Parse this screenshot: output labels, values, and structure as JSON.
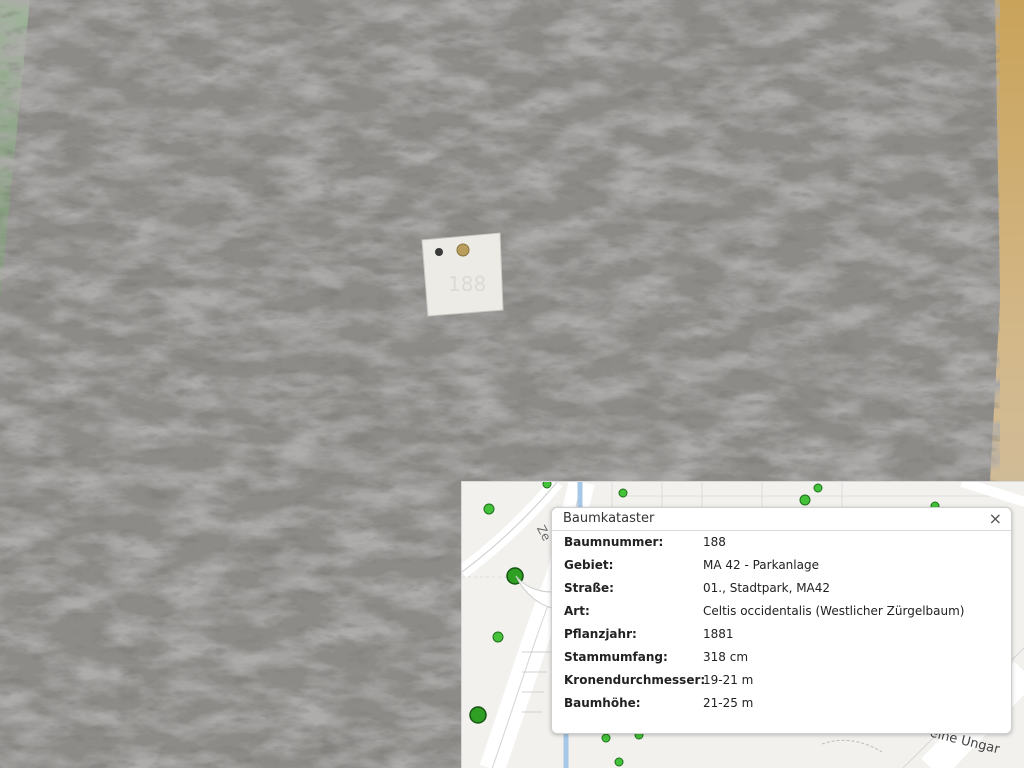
{
  "popup": {
    "title": "Baumkataster",
    "close_symbol": "×",
    "rows": [
      {
        "label": "Baumnummer:",
        "value": "188"
      },
      {
        "label": "Gebiet:",
        "value": "MA 42 - Parkanlage"
      },
      {
        "label": "Straße:",
        "value": "01., Stadtpark, MA42"
      },
      {
        "label": "Art:",
        "value": "Celtis occidentalis (Westlicher Zürgelbaum)"
      },
      {
        "label": "Pflanzjahr:",
        "value": "1881"
      },
      {
        "label": "Stammumfang:",
        "value": "318 cm"
      },
      {
        "label": "Kronendurchmesser:",
        "value": "19-21 m"
      },
      {
        "label": "Baumhöhe:",
        "value": "21-25 m"
      }
    ]
  },
  "map": {
    "street_labels": {
      "left": "Ze",
      "bottom_right": "eine Ungar"
    },
    "marker_color": "#44c23a",
    "marker_stroke": "#1f6e1a"
  },
  "photo": {
    "tag_number": "188"
  },
  "icons": {
    "close": "close-icon",
    "tree_marker": "tree-marker-icon"
  }
}
